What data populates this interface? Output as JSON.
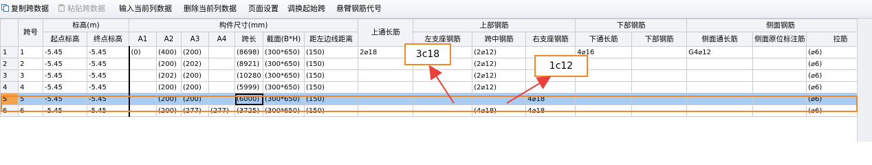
{
  "toolbar": {
    "copy_span": "复制跨数据",
    "paste_span": "粘贴跨数据",
    "input_current_column": "输入当前列数据",
    "delete_current_column": "删除当前列数据",
    "page_setup": "页面设置",
    "swap_start_span": "调换起始跨",
    "cantilever_code": "悬臂钢筋代号"
  },
  "header": {
    "span_no": "跨号",
    "elevation_group": "标高(m)",
    "start_elev": "起点标高",
    "end_elev": "终点标高",
    "dimension_group": "构件尺寸(mm)",
    "a1": "A1",
    "a2": "A2",
    "a3": "A3",
    "a4": "A4",
    "span_len": "跨长",
    "section": "截面(B*H)",
    "dist_left": "距左边线距离",
    "top_through": "上通长筋",
    "top_group": "上部钢筋",
    "left_support": "左支座钢筋",
    "mid_span": "跨中钢筋",
    "right_support": "右支座钢筋",
    "bottom_group": "下部钢筋",
    "bottom_through": "下通长筋",
    "bottom_rebar": "下部钢筋",
    "side_group": "侧面钢筋",
    "side_through": "侧面通长筋",
    "side_orig": "侧面原位标注筋",
    "tie": "拉筋"
  },
  "rows": [
    {
      "rn": "1",
      "span": "1",
      "start": "-5.45",
      "end": "-5.45",
      "a1": "(0)",
      "a2": "(400)",
      "a3": "(200)",
      "a4": "",
      "len": "(8698)",
      "sec": "(300*650)",
      "dist": "(150)",
      "top": "2⌀18",
      "left": "",
      "mid": "(2⌀12)",
      "right": "",
      "bthru": "4⌀16",
      "bot": "",
      "sthru": "G4⌀12",
      "sorig": "",
      "tie": "(⌀6)"
    },
    {
      "rn": "2",
      "span": "2",
      "start": "-5.45",
      "end": "-5.45",
      "a1": "",
      "a2": "(200)",
      "a3": "(202)",
      "a4": "",
      "len": "(8921)",
      "sec": "(300*650)",
      "dist": "(150)",
      "top": "",
      "left": "",
      "mid": "(2⌀12)",
      "right": "",
      "bthru": "",
      "bot": "",
      "sthru": "",
      "sorig": "",
      "tie": "(⌀6)"
    },
    {
      "rn": "3",
      "span": "3",
      "start": "-5.45",
      "end": "-5.45",
      "a1": "",
      "a2": "(202)",
      "a3": "(200)",
      "a4": "",
      "len": "(10280",
      "sec": "(300*650)",
      "dist": "(150)",
      "top": "",
      "left": "",
      "mid": "(2⌀12)",
      "right": "",
      "bthru": "",
      "bot": "",
      "sthru": "",
      "sorig": "",
      "tie": "(⌀6)"
    },
    {
      "rn": "4",
      "span": "4",
      "start": "-5.45",
      "end": "-5.45",
      "a1": "",
      "a2": "(200)",
      "a3": "(200)",
      "a4": "",
      "len": "(5999)",
      "sec": "(300*650)",
      "dist": "(150)",
      "top": "",
      "left": "",
      "mid": "(2⌀12)",
      "right": "",
      "bthru": "",
      "bot": "",
      "sthru": "",
      "sorig": "",
      "tie": "(⌀6)"
    },
    {
      "rn": "5",
      "span": "5",
      "start": "-5.45",
      "end": "-5.45",
      "a1": "",
      "a2": "(200)",
      "a3": "(200)",
      "a4": "",
      "len": "(6000)",
      "sec": "(300*650)",
      "dist": "(150)",
      "top": "",
      "left": "",
      "mid": "",
      "right": "4⌀18",
      "bthru": "",
      "bot": "",
      "sthru": "",
      "sorig": "",
      "tie": "(⌀6)"
    },
    {
      "rn": "6",
      "span": "6",
      "start": "-5.45",
      "end": "-5.45",
      "a1": "",
      "a2": "(200)",
      "a3": "(277)",
      "a4": "(277)",
      "len": "(3725)",
      "sec": "(300*650)",
      "dist": "(150)",
      "top": "",
      "left": "",
      "mid": "(4⌀18)",
      "right": "4⌀18",
      "bthru": "",
      "bot": "",
      "sthru": "",
      "sorig": "",
      "tie": "(⌀6)"
    }
  ],
  "callouts": {
    "left": "3c18",
    "right": "1c12"
  },
  "colors": {
    "accent_orange": "#f0892c",
    "selected_row": "#a9cdf2",
    "arrow_red": "#e8403a"
  }
}
